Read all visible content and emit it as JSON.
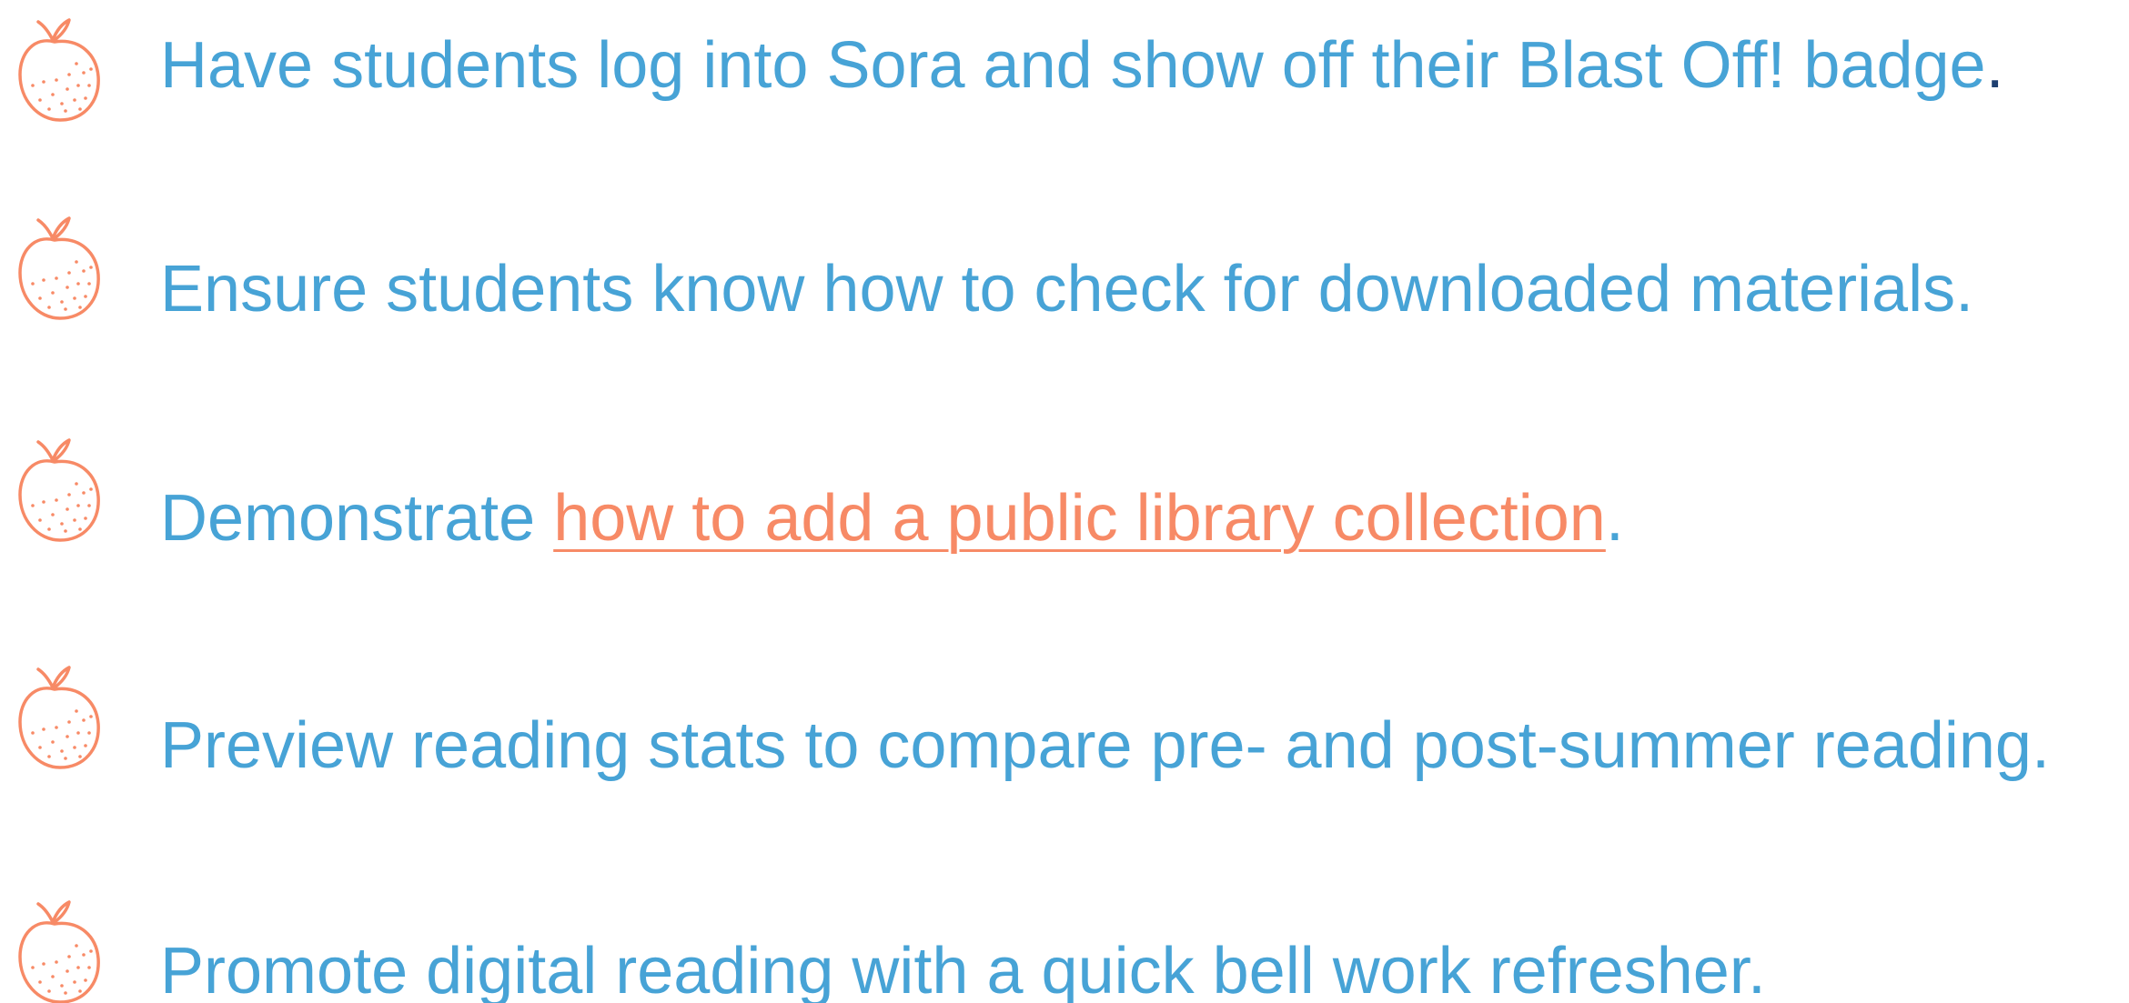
{
  "items": [
    {
      "before": "Have students log into Sora and show off their Blast Off! badge",
      "after": "."
    },
    {
      "before": "Ensure students know how to check for downloaded materials.",
      "after": ""
    },
    {
      "before": "Demonstrate ",
      "link": "how to add a public library collection",
      "after": "."
    },
    {
      "before": "Preview reading stats to compare pre- and post-summer reading.",
      "after": ""
    },
    {
      "before": "Promote digital reading with a quick bell work refresher.",
      "after": ""
    }
  ],
  "colors": {
    "text": "#47a3d6",
    "link": "#f78a66",
    "icon": "#f78a66",
    "period_dark": "#1e3f70"
  },
  "icon_name": "orange-fruit-icon"
}
